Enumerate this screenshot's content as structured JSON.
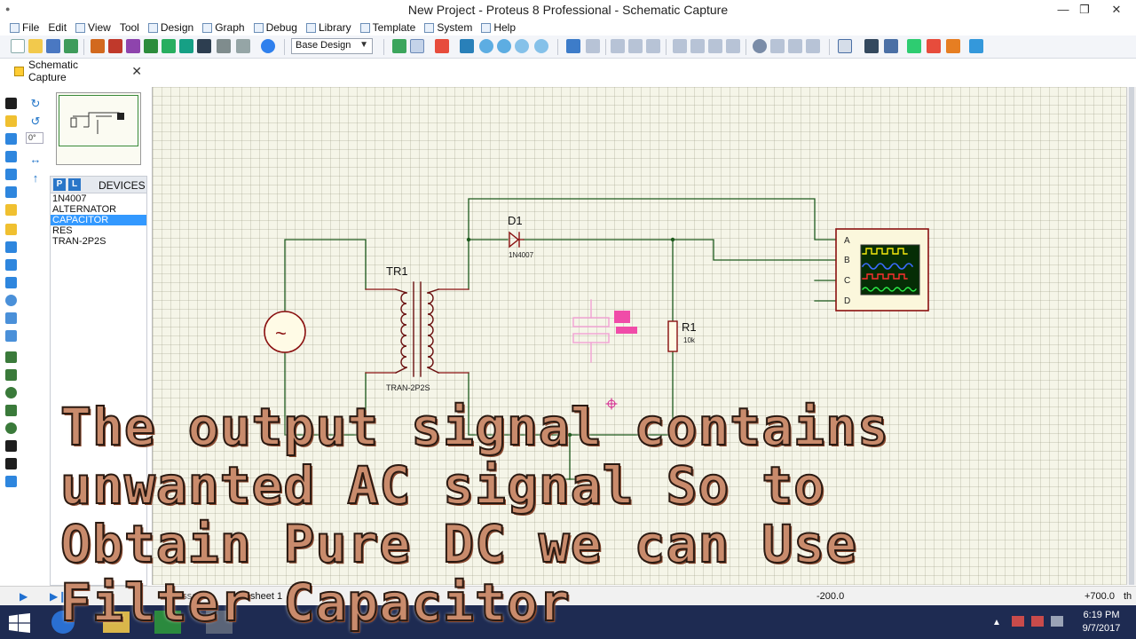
{
  "window": {
    "title": "New Project - Proteus 8 Professional - Schematic Capture",
    "minimize": "—",
    "restore": "❐",
    "close": "✕"
  },
  "menu": {
    "items": [
      "File",
      "Edit",
      "View",
      "Tool",
      "Design",
      "Graph",
      "Debug",
      "Library",
      "Template",
      "System",
      "Help"
    ]
  },
  "toolbar": {
    "design_select": "Base Design"
  },
  "tabs": [
    {
      "label": "Schematic Capture",
      "close": "✕"
    }
  ],
  "left_panel": {
    "angle": "0°",
    "p_button": "P",
    "l_button": "L",
    "devices_title": "DEVICES",
    "devices": [
      "1N4007",
      "ALTERNATOR",
      "CAPACITOR",
      "RES",
      "TRAN-2P2S"
    ],
    "selected_device": "CAPACITOR"
  },
  "schematic": {
    "transformer_ref": "TR1",
    "transformer_part": "TRAN-2P2S",
    "diode_ref": "D1",
    "diode_part": "1N4007",
    "resistor_ref": "R1",
    "resistor_value": "10k",
    "scope_channels": [
      "A",
      "B",
      "C",
      "D"
    ],
    "alternator_symbol": "~"
  },
  "status": {
    "message": "Messages",
    "sheet": "sheet 1",
    "x_coord": "-200.0",
    "y_coord": "+700.0",
    "unit": "th"
  },
  "taskbar": {
    "time": "6:19 PM",
    "date": "9/7/2017"
  },
  "caption": {
    "lines": [
      "The output signal contains",
      "unwanted AC signal So to",
      "Obtain Pure DC we can Use",
      "Filter Capacitor"
    ]
  }
}
